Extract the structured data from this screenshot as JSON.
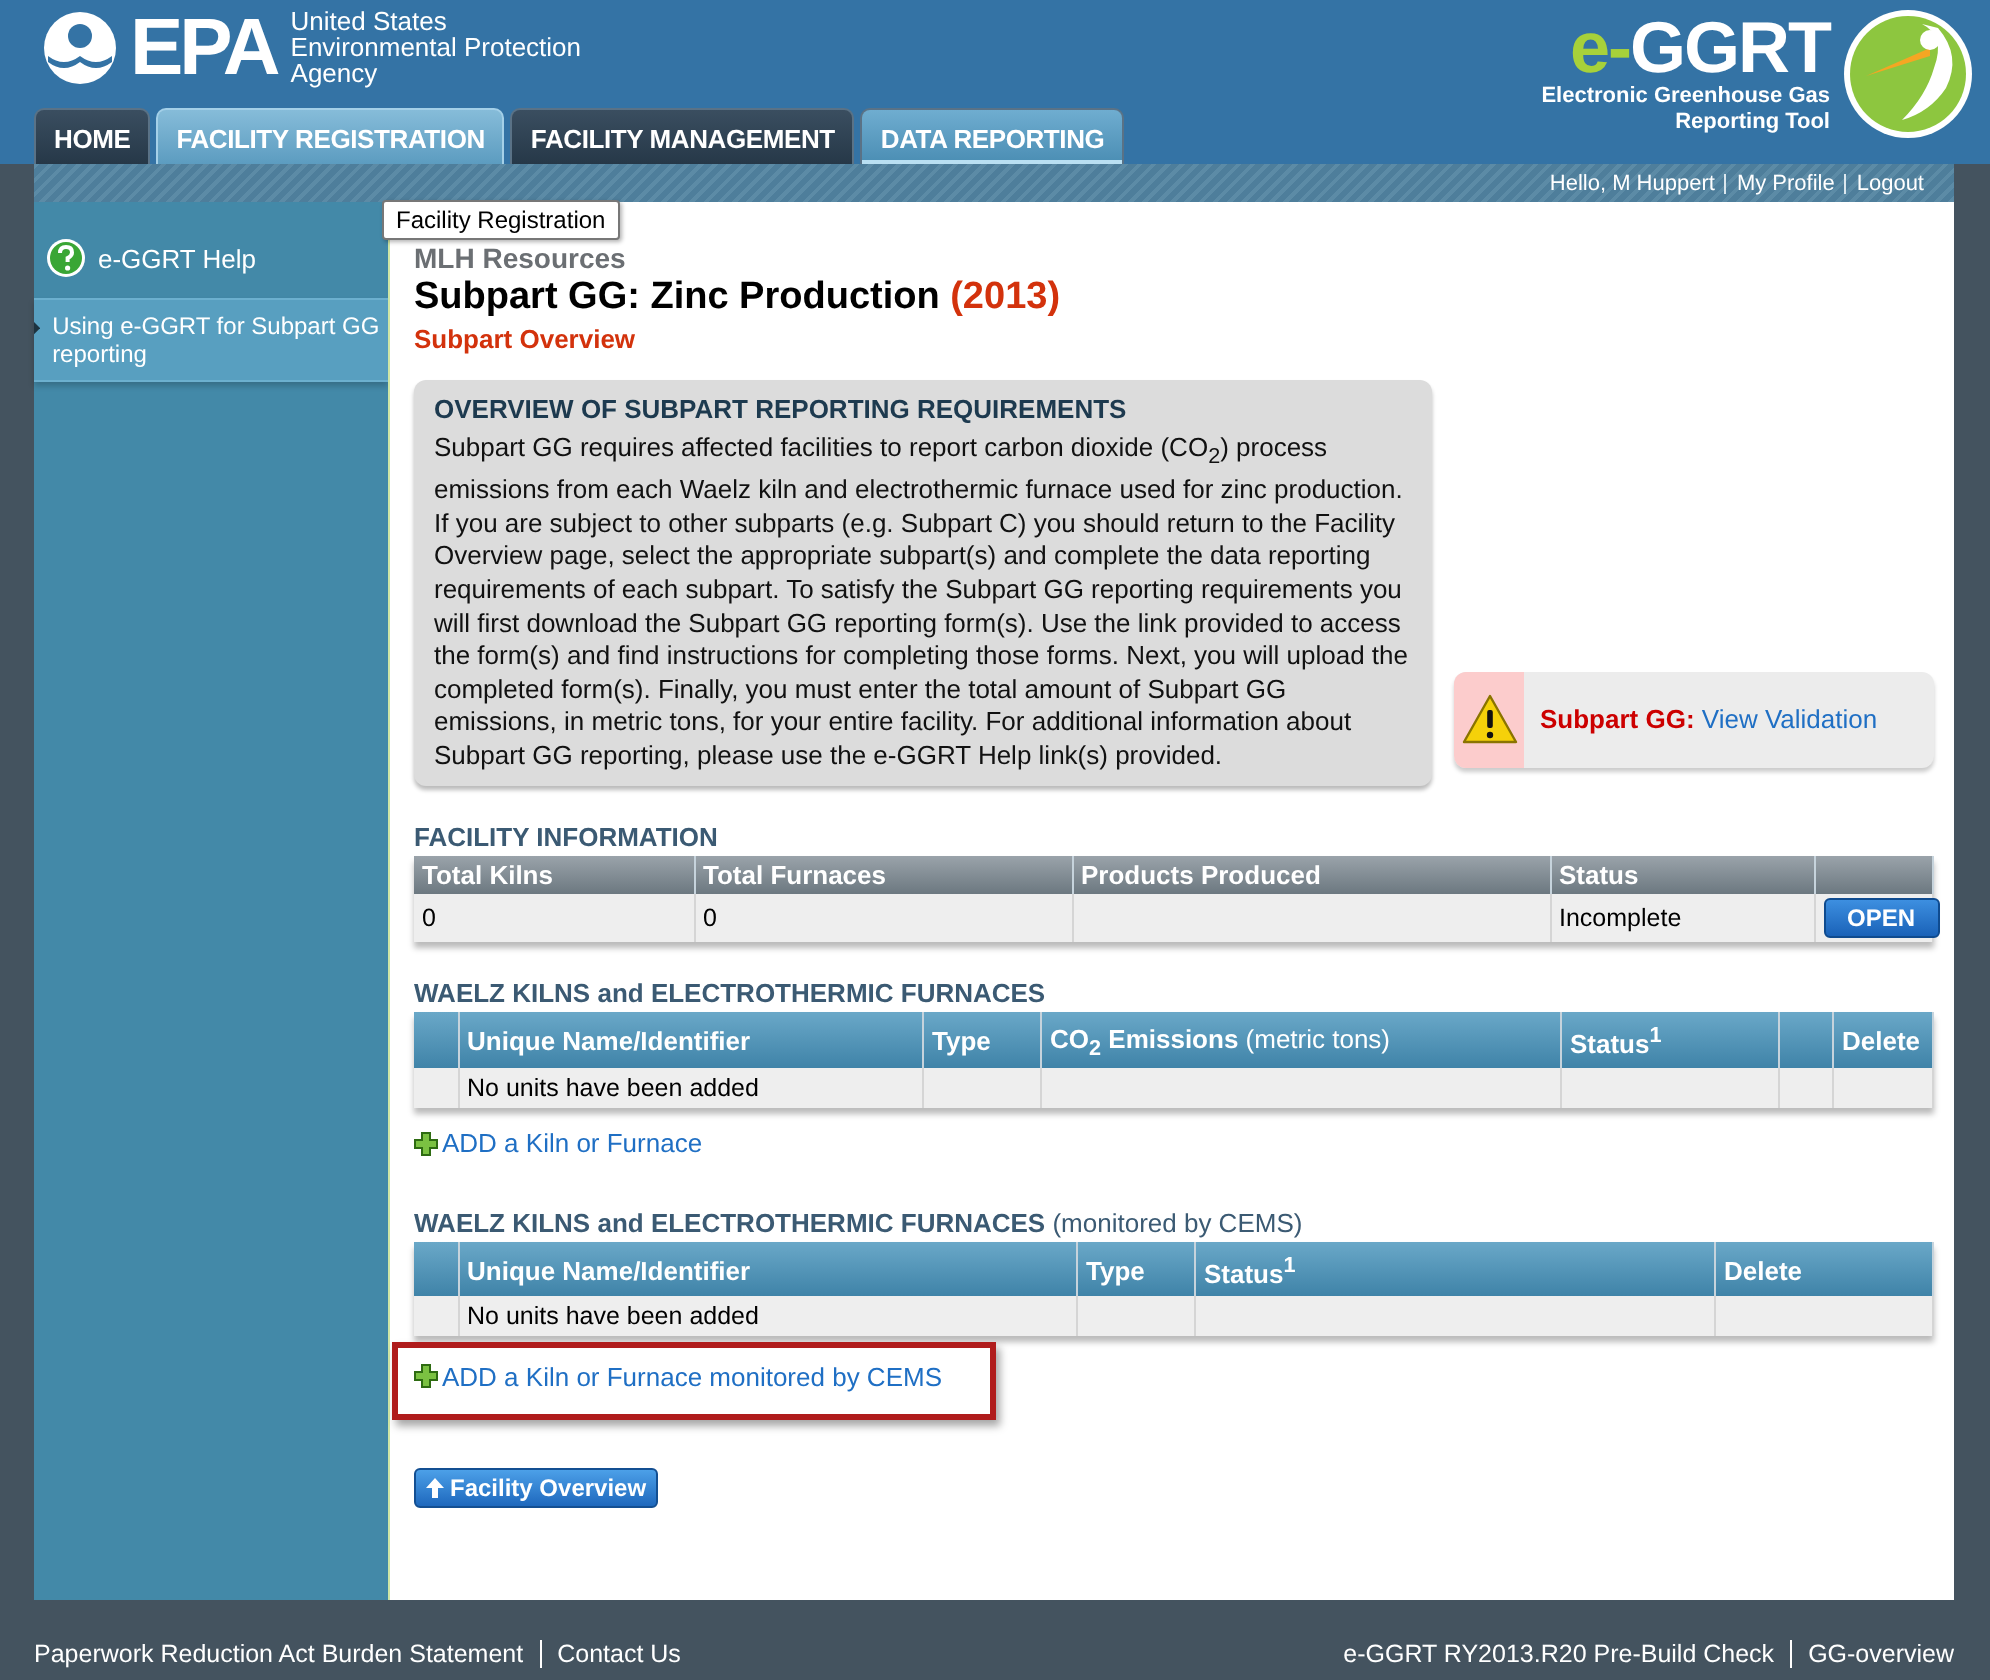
{
  "header": {
    "agency_mark": "EPA",
    "agency_name": [
      "United States",
      "Environmental Protection",
      "Agency"
    ],
    "app_logo": {
      "prefix": "e-",
      "name": "GGRT",
      "subtitle": [
        "Electronic Greenhouse Gas",
        "Reporting Tool"
      ]
    }
  },
  "tabs": [
    {
      "label": "HOME",
      "selected": false,
      "hovered": false
    },
    {
      "label": "FACILITY REGISTRATION",
      "selected": false,
      "hovered": true
    },
    {
      "label": "FACILITY MANAGEMENT",
      "selected": false,
      "hovered": false
    },
    {
      "label": "DATA REPORTING",
      "selected": true,
      "hovered": false
    }
  ],
  "tooltip": "Facility Registration",
  "user_bar": [
    "Hello, M Huppert",
    "My Profile",
    "Logout"
  ],
  "sidebar": {
    "items": [
      {
        "kind": "help",
        "label": "e-GGRT Help",
        "selected": false
      },
      {
        "kind": "link",
        "label": "Using e-GGRT for Subpart GG reporting",
        "selected": true
      }
    ]
  },
  "content": {
    "facility": "MLH Resources",
    "title": "Subpart GG: Zinc Production",
    "year": "(2013)",
    "subtitle": "Subpart Overview",
    "overview": {
      "heading": "OVERVIEW OF SUBPART REPORTING REQUIREMENTS",
      "text": "Subpart GG requires affected facilities to report carbon dioxide (CO$_{2}$) process emissions from each Waelz kiln and electrothermic furnace used for zinc production. If you are subject to other subparts (e.g. Subpart C) you should return to the Facility Overview page, select the appropriate subpart(s) and complete the data reporting requirements of each subpart. To satisfy the Subpart GG reporting requirements you will first download the Subpart GG reporting form(s). Use the link provided to access the form(s) and find instructions for completing those forms. Next, you will upload the completed form(s). Finally, you must enter the total amount of Subpart GG emissions, in metric tons, for your entire facility. For additional information about Subpart GG reporting, please use the e-GGRT Help link(s) provided."
    },
    "validation": {
      "label": "Subpart GG:",
      "link": "View Validation"
    },
    "sections": [
      {
        "title": "FACILITY INFORMATION",
        "kind": "summary",
        "columns": [
          {
            "kind": "text",
            "label": "Total Kilns"
          },
          {
            "kind": "text",
            "label": "Total Furnaces"
          },
          {
            "kind": "text",
            "label": "Products Produced"
          },
          {
            "kind": "text",
            "label": "Status"
          },
          {
            "kind": "spacer"
          }
        ],
        "rows": [
          {
            "cells": [
              "0",
              "0",
              null,
              "Incomplete"
            ],
            "action": "OPEN"
          }
        ]
      },
      {
        "title": "WAELZ KILNS and ELECTROTHERMIC FURNACES",
        "kind": "units",
        "columns": [
          {
            "kind": "spacer"
          },
          {
            "kind": "text",
            "label": "Unique Name/Identifier"
          },
          {
            "kind": "text",
            "label": "Type"
          },
          {
            "kind": "text",
            "label": "CO$_{2}$ Emissions",
            "note": "(metric tons)"
          },
          {
            "kind": "text",
            "label": "Status$^{1}$"
          },
          {
            "kind": "spacer"
          },
          {
            "kind": "text",
            "label": "Delete"
          }
        ],
        "empty_message": "No units have been added",
        "add_link": {
          "label": "ADD a Kiln or Furnace",
          "highlighted": false
        }
      },
      {
        "title": "WAELZ KILNS and ELECTROTHERMIC FURNACES",
        "note": "(monitored by CEMS)",
        "kind": "units",
        "columns": [
          {
            "kind": "spacer"
          },
          {
            "kind": "text",
            "label": "Unique Name/Identifier"
          },
          {
            "kind": "text",
            "label": "Type"
          },
          {
            "kind": "text",
            "label": "Status$^{1}$"
          },
          {
            "kind": "text",
            "label": "Delete"
          }
        ],
        "empty_message": "No units have been added",
        "add_link": {
          "label": "ADD a Kiln or Furnace monitored by CEMS",
          "highlighted": true
        }
      }
    ],
    "back_button": "Facility Overview"
  },
  "footer": {
    "left": [
      "Paperwork Reduction Act Burden Statement",
      "Contact Us"
    ],
    "right": [
      "e-GGRT RY2013.R20 Pre-Build Check",
      "GG-overview"
    ]
  }
}
